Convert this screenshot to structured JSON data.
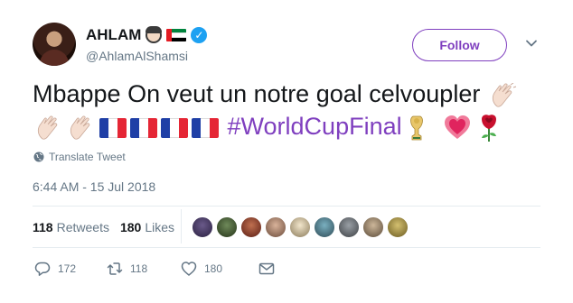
{
  "user": {
    "display_name": "AHLAM",
    "handle": "@AhlamAlShamsi",
    "avatar_icon": "profile-photo",
    "badges": [
      "woman-emoji",
      "uae-flag-emoji",
      "verified-badge-icon"
    ]
  },
  "follow_button": {
    "label": "Follow"
  },
  "tweet": {
    "text_main": "Mbappe On veut un notre goal celvoupler",
    "hashtag": "#WorldCupFinal",
    "emojis": [
      "clapping-hands",
      "clapping-hands",
      "clapping-hands",
      "france-flag",
      "france-flag",
      "france-flag",
      "france-flag",
      "trophy",
      "sparkling-heart",
      "rose"
    ]
  },
  "translate": {
    "label": "Translate Tweet"
  },
  "timestamp": "6:44 AM - 15 Jul 2018",
  "stats": {
    "retweets_count": "118",
    "retweets_label": "Retweets",
    "likes_count": "180",
    "likes_label": "Likes"
  },
  "actions": {
    "replies": "172",
    "retweets": "118",
    "likes": "180"
  },
  "colors": {
    "accent": "#7f3fbf",
    "verified": "#1da1f2",
    "secondary_text": "#657786",
    "divider": "#e6ecf0"
  }
}
